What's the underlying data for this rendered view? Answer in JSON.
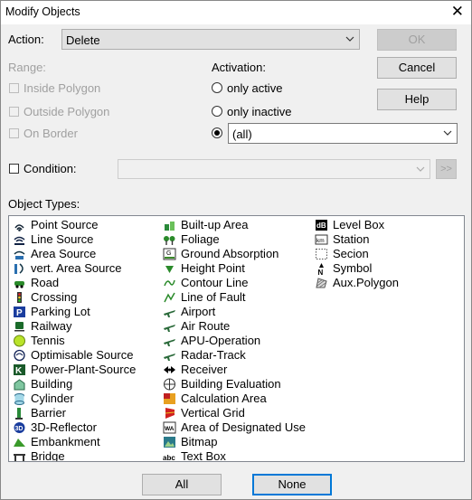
{
  "window": {
    "title": "Modify Objects",
    "close_glyph": "✕"
  },
  "action": {
    "label": "Action:",
    "value": "Delete"
  },
  "buttons": {
    "ok": "OK",
    "cancel": "Cancel",
    "help": "Help",
    "all": "All",
    "none": "None",
    "more": ">>"
  },
  "range": {
    "label": "Range:",
    "inside": "Inside Polygon",
    "outside": "Outside Polygon",
    "border": "On Border"
  },
  "activation": {
    "label": "Activation:",
    "only_active": "only active",
    "only_inactive": "only inactive",
    "all_value": "(all)",
    "selected": "all"
  },
  "condition": {
    "label": "Condition:",
    "value": ""
  },
  "object_types": {
    "label": "Object Types:",
    "col1": [
      {
        "label": "Point Source",
        "icon": "point-source-icon"
      },
      {
        "label": "Line Source",
        "icon": "line-source-icon"
      },
      {
        "label": "Area Source",
        "icon": "area-source-icon"
      },
      {
        "label": "vert. Area Source",
        "icon": "vert-area-source-icon"
      },
      {
        "label": "Road",
        "icon": "road-car-icon"
      },
      {
        "label": "Crossing",
        "icon": "traffic-light-icon"
      },
      {
        "label": "Parking Lot",
        "icon": "parking-icon"
      },
      {
        "label": "Railway",
        "icon": "train-icon"
      },
      {
        "label": "Tennis",
        "icon": "tennis-ball-icon"
      },
      {
        "label": "Optimisable Source",
        "icon": "optimisable-source-icon"
      },
      {
        "label": "Power-Plant-Source",
        "icon": "power-plant-icon"
      },
      {
        "label": "Building",
        "icon": "building-icon"
      },
      {
        "label": "Cylinder",
        "icon": "cylinder-icon"
      },
      {
        "label": "Barrier",
        "icon": "barrier-icon"
      },
      {
        "label": "3D-Reflector",
        "icon": "reflector-3d-icon"
      },
      {
        "label": "Embankment",
        "icon": "embankment-icon"
      },
      {
        "label": "Bridge",
        "icon": "bridge-icon"
      }
    ],
    "col2": [
      {
        "label": "Built-up Area",
        "icon": "built-up-area-icon"
      },
      {
        "label": "Foliage",
        "icon": "foliage-icon"
      },
      {
        "label": "Ground Absorption",
        "icon": "ground-absorption-icon"
      },
      {
        "label": "Height Point",
        "icon": "height-point-icon"
      },
      {
        "label": "Contour Line",
        "icon": "contour-line-icon"
      },
      {
        "label": "Line of Fault",
        "icon": "line-of-fault-icon"
      },
      {
        "label": "Airport",
        "icon": "airport-icon"
      },
      {
        "label": "Air Route",
        "icon": "air-route-icon"
      },
      {
        "label": "APU-Operation",
        "icon": "apu-operation-icon"
      },
      {
        "label": "Radar-Track",
        "icon": "radar-track-icon"
      },
      {
        "label": "Receiver",
        "icon": "receiver-icon"
      },
      {
        "label": "Building Evaluation",
        "icon": "building-evaluation-icon"
      },
      {
        "label": "Calculation Area",
        "icon": "calculation-area-icon"
      },
      {
        "label": "Vertical Grid",
        "icon": "vertical-grid-icon"
      },
      {
        "label": "Area of Designated Use",
        "icon": "designated-use-icon"
      },
      {
        "label": "Bitmap",
        "icon": "bitmap-icon"
      },
      {
        "label": "Text Box",
        "icon": "text-box-icon"
      }
    ],
    "col3": [
      {
        "label": "Level Box",
        "icon": "level-box-icon"
      },
      {
        "label": "Station",
        "icon": "station-icon"
      },
      {
        "label": "Secion",
        "icon": "section-icon"
      },
      {
        "label": "Symbol",
        "icon": "north-symbol-icon"
      },
      {
        "label": "Aux.Polygon",
        "icon": "aux-polygon-icon"
      }
    ]
  },
  "colors": {
    "accent": "#0078d7",
    "dialog_bg": "#f0f0f0",
    "disabled_text": "#a0a0a0"
  }
}
